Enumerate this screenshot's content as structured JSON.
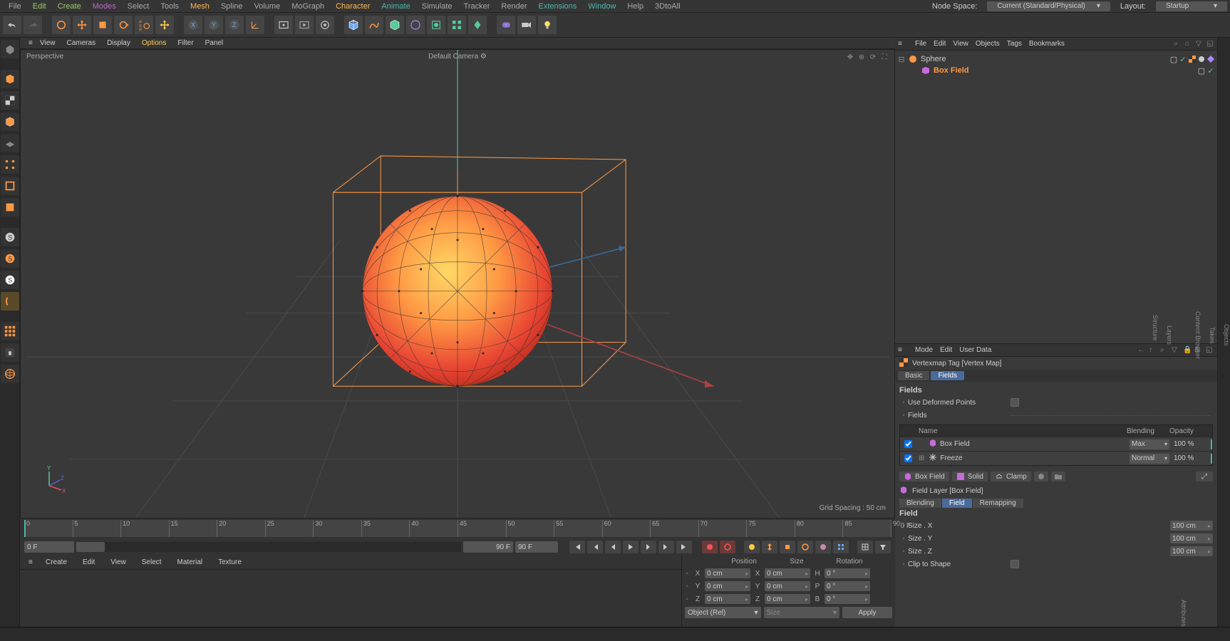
{
  "menubar": {
    "file": "File",
    "edit": "Edit",
    "create": "Create",
    "modes": "Modes",
    "select": "Select",
    "tools": "Tools",
    "mesh": "Mesh",
    "spline": "Spline",
    "volume": "Volume",
    "mograph": "MoGraph",
    "character": "Character",
    "animate": "Animate",
    "simulate": "Simulate",
    "tracker": "Tracker",
    "render": "Render",
    "extensions": "Extensions",
    "window": "Window",
    "help": "Help",
    "_3dtoall": "3DtoAll"
  },
  "nodespace": {
    "label": "Node Space:",
    "value": "Current (Standard/Physical)"
  },
  "layout": {
    "label": "Layout:",
    "value": "Startup"
  },
  "viewport_menu": {
    "view": "View",
    "cameras": "Cameras",
    "display": "Display",
    "options": "Options",
    "filter": "Filter",
    "panel": "Panel"
  },
  "viewport": {
    "label": "Perspective",
    "camera": "Default Camera",
    "grid": "Grid Spacing : 50 cm"
  },
  "timeline": {
    "start": "0",
    "end": "90",
    "unit": "F",
    "ticks": [
      "0",
      "5",
      "10",
      "15",
      "20",
      "25",
      "30",
      "35",
      "40",
      "45",
      "50",
      "55",
      "60",
      "65",
      "70",
      "75",
      "80",
      "85",
      "90"
    ],
    "start_field": "0 F",
    "end_field": "90 F",
    "curstart": "0 F",
    "curend": "90 F"
  },
  "bottom_menu": {
    "create": "Create",
    "edit": "Edit",
    "view": "View",
    "select": "Select",
    "material": "Material",
    "texture": "Texture"
  },
  "coords": {
    "position": "Position",
    "size": "Size",
    "rotation": "Rotation",
    "x": "X",
    "y": "Y",
    "z": "Z",
    "xp": "0 cm",
    "yp": "0 cm",
    "zp": "0 cm",
    "xs": "0 cm",
    "ys": "0 cm",
    "zs": "0 cm",
    "h": "H",
    "p": "P",
    "b": "B",
    "hv": "0 °",
    "pv": "0 °",
    "bv": "0 °",
    "mode": "Object (Rel)",
    "sizemode": "Size",
    "apply": "Apply"
  },
  "objman": {
    "menu": {
      "file": "File",
      "edit": "Edit",
      "view": "View",
      "objects": "Objects",
      "tags": "Tags",
      "bookmarks": "Bookmarks"
    },
    "sphere": "Sphere",
    "boxfield": "Box Field"
  },
  "attr": {
    "menu": {
      "mode": "Mode",
      "edit": "Edit",
      "userdata": "User Data"
    },
    "title": "Vertexmap Tag [Vertex Map]",
    "tab_basic": "Basic",
    "tab_fields": "Fields",
    "sec_fields": "Fields",
    "use_deformed": "Use Deformed Points",
    "fields_lbl": "Fields",
    "col_name": "Name",
    "col_blend": "Blending",
    "col_opac": "Opacity",
    "row_box": "Box Field",
    "row_box_blend": "Max",
    "row_box_opac": "100 %",
    "row_freeze": "Freeze",
    "row_freeze_blend": "Normal",
    "row_freeze_opac": "100 %",
    "btn_box": "Box Field",
    "btn_solid": "Solid",
    "btn_clamp": "Clamp",
    "layer_title": "Field Layer [Box Field]",
    "ft_blend": "Blending",
    "ft_field": "Field",
    "ft_remap": "Remapping",
    "sec_field": "Field",
    "size_x": "Size . X",
    "size_y": "Size . Y",
    "size_z": "Size . Z",
    "size_xv": "100 cm",
    "size_yv": "100 cm",
    "size_zv": "100 cm",
    "clip": "Clip to Shape"
  },
  "side_tabs": {
    "objects": "Objects",
    "takes": "Takes",
    "content": "Content Browser",
    "attributes": "Attributes",
    "layers": "Layers",
    "structure": "Structure"
  }
}
